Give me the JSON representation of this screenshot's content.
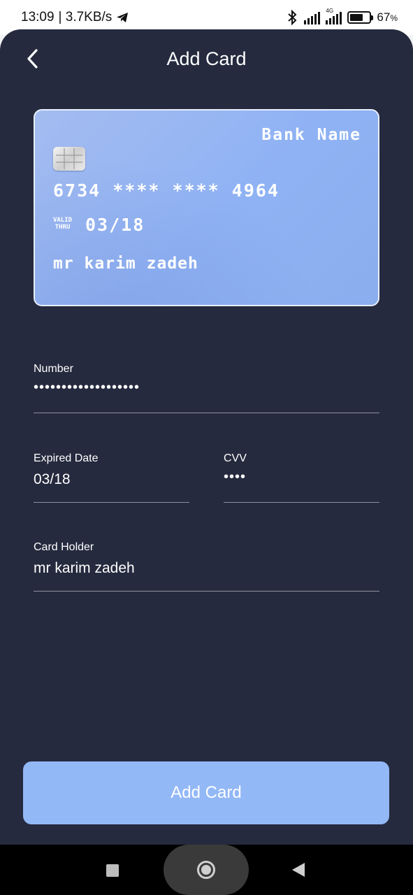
{
  "status_bar": {
    "time": "13:09",
    "speed": "| 3.7KB/s",
    "network_type": "4G",
    "battery": "67",
    "battery_level": 0.67,
    "battery_unit": "%"
  },
  "header": {
    "title": "Add Card"
  },
  "card": {
    "bank_name": "Bank Name",
    "number": "6734 **** **** 4964",
    "valid_line1": "VALID",
    "valid_line2": "THRU",
    "expiry": "03/18",
    "holder": "mr karim zadeh"
  },
  "form": {
    "number_label": "Number",
    "number_value": "•••••••••••••••••••",
    "expiry_label": "Expired Date",
    "expiry_value": "03/18",
    "cvv_label": "CVV",
    "cvv_value": "••••",
    "holder_label": "Card Holder",
    "holder_value": "mr karim zadeh"
  },
  "submit_label": "Add Card",
  "colors": {
    "background": "#252a3e",
    "card": "#8fb2f4",
    "button": "#93b8f6"
  }
}
